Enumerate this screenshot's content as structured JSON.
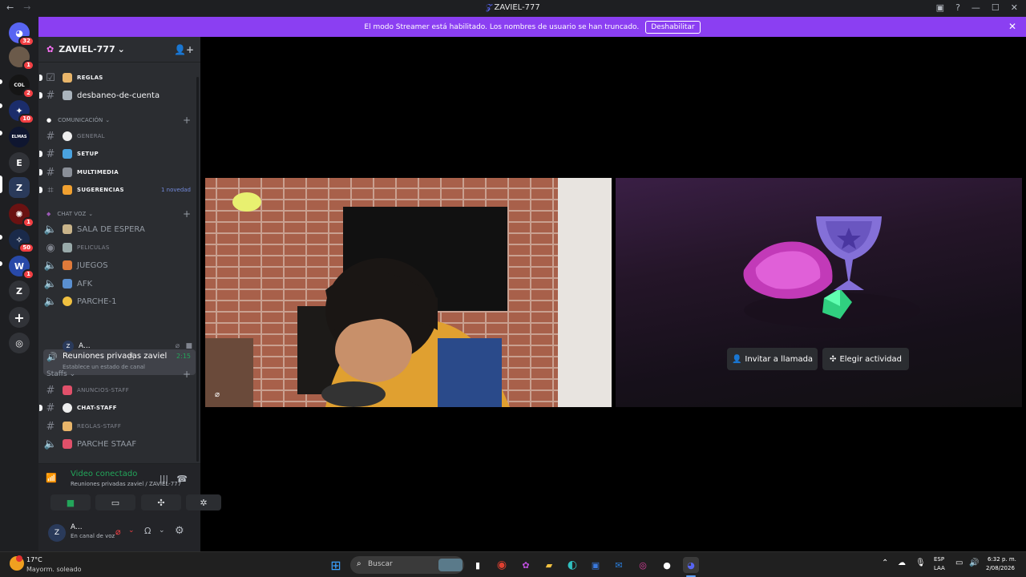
{
  "window": {
    "title": "ZAVIEL-777"
  },
  "banner": {
    "text": "El modo Streamer está habilitado. Los nombres de usuario se han truncado.",
    "button": "Deshabilitar"
  },
  "servers": [
    {
      "label": "",
      "badge": "32"
    },
    {
      "label": "",
      "badge": "1"
    },
    {
      "label": "",
      "badge": "2"
    },
    {
      "label": "",
      "badge": "10"
    },
    {
      "label": "",
      "badge": ""
    },
    {
      "label": "E",
      "badge": ""
    },
    {
      "label": "",
      "badge": ""
    },
    {
      "label": "",
      "badge": "1"
    },
    {
      "label": "",
      "badge": "50"
    },
    {
      "label": "",
      "badge": "1"
    },
    {
      "label": "Z",
      "badge": ""
    }
  ],
  "guild": {
    "name": "ZAVIEL-777"
  },
  "channels": {
    "reglas": "REGLAS",
    "desbaneo": "desbaneo-de-cuenta",
    "cat_comunicacion": "COMUNICACIÓN",
    "general": "GENERAL",
    "setup": "SETUP",
    "multimedia": "MULTIMEDIA",
    "sugerencias": "SUGERENCIAS",
    "sugerencias_badge": "1 novedad",
    "cat_chatvoz": "CHAT VOZ",
    "sala": "SALA DE ESPERA",
    "peliculas": "PELICULAS",
    "juegos": "JUEGOS",
    "afk": "AFK",
    "parche1": "PARCHE-1",
    "reuniones": "Reuniones privadas zaviel",
    "reuniones_time": "2:15",
    "reuniones_status": "Establece un estado de canal",
    "user_in_voice": "A...",
    "cat_staffs": "Staffs",
    "anuncios_staff": "ANUNCIOS-STAFF",
    "chat_staff": "CHAT-STAFF",
    "reglas_staff": "REGLAS-STAFF",
    "parche_staaf": "PARCHE STAAF"
  },
  "voice": {
    "status": "Video conectado",
    "location": "Reuniones privadas zaviel / ZAVIEL-777"
  },
  "user": {
    "name": "A...",
    "status": "En canal de voz"
  },
  "activity": {
    "invite": "Invitar a llamada",
    "choose": "Elegir actividad"
  },
  "taskbar": {
    "weather_temp": "17°C",
    "weather_desc": "Mayorm. soleado",
    "search": "Buscar",
    "lang1": "ESP",
    "lang2": "LAA",
    "time": "6:32 p. m.",
    "date": "2/08/2026"
  },
  "colors": {
    "accent": "#5865f2",
    "banner": "#8b3ff2",
    "green": "#23a55a",
    "red": "#f23f43"
  }
}
